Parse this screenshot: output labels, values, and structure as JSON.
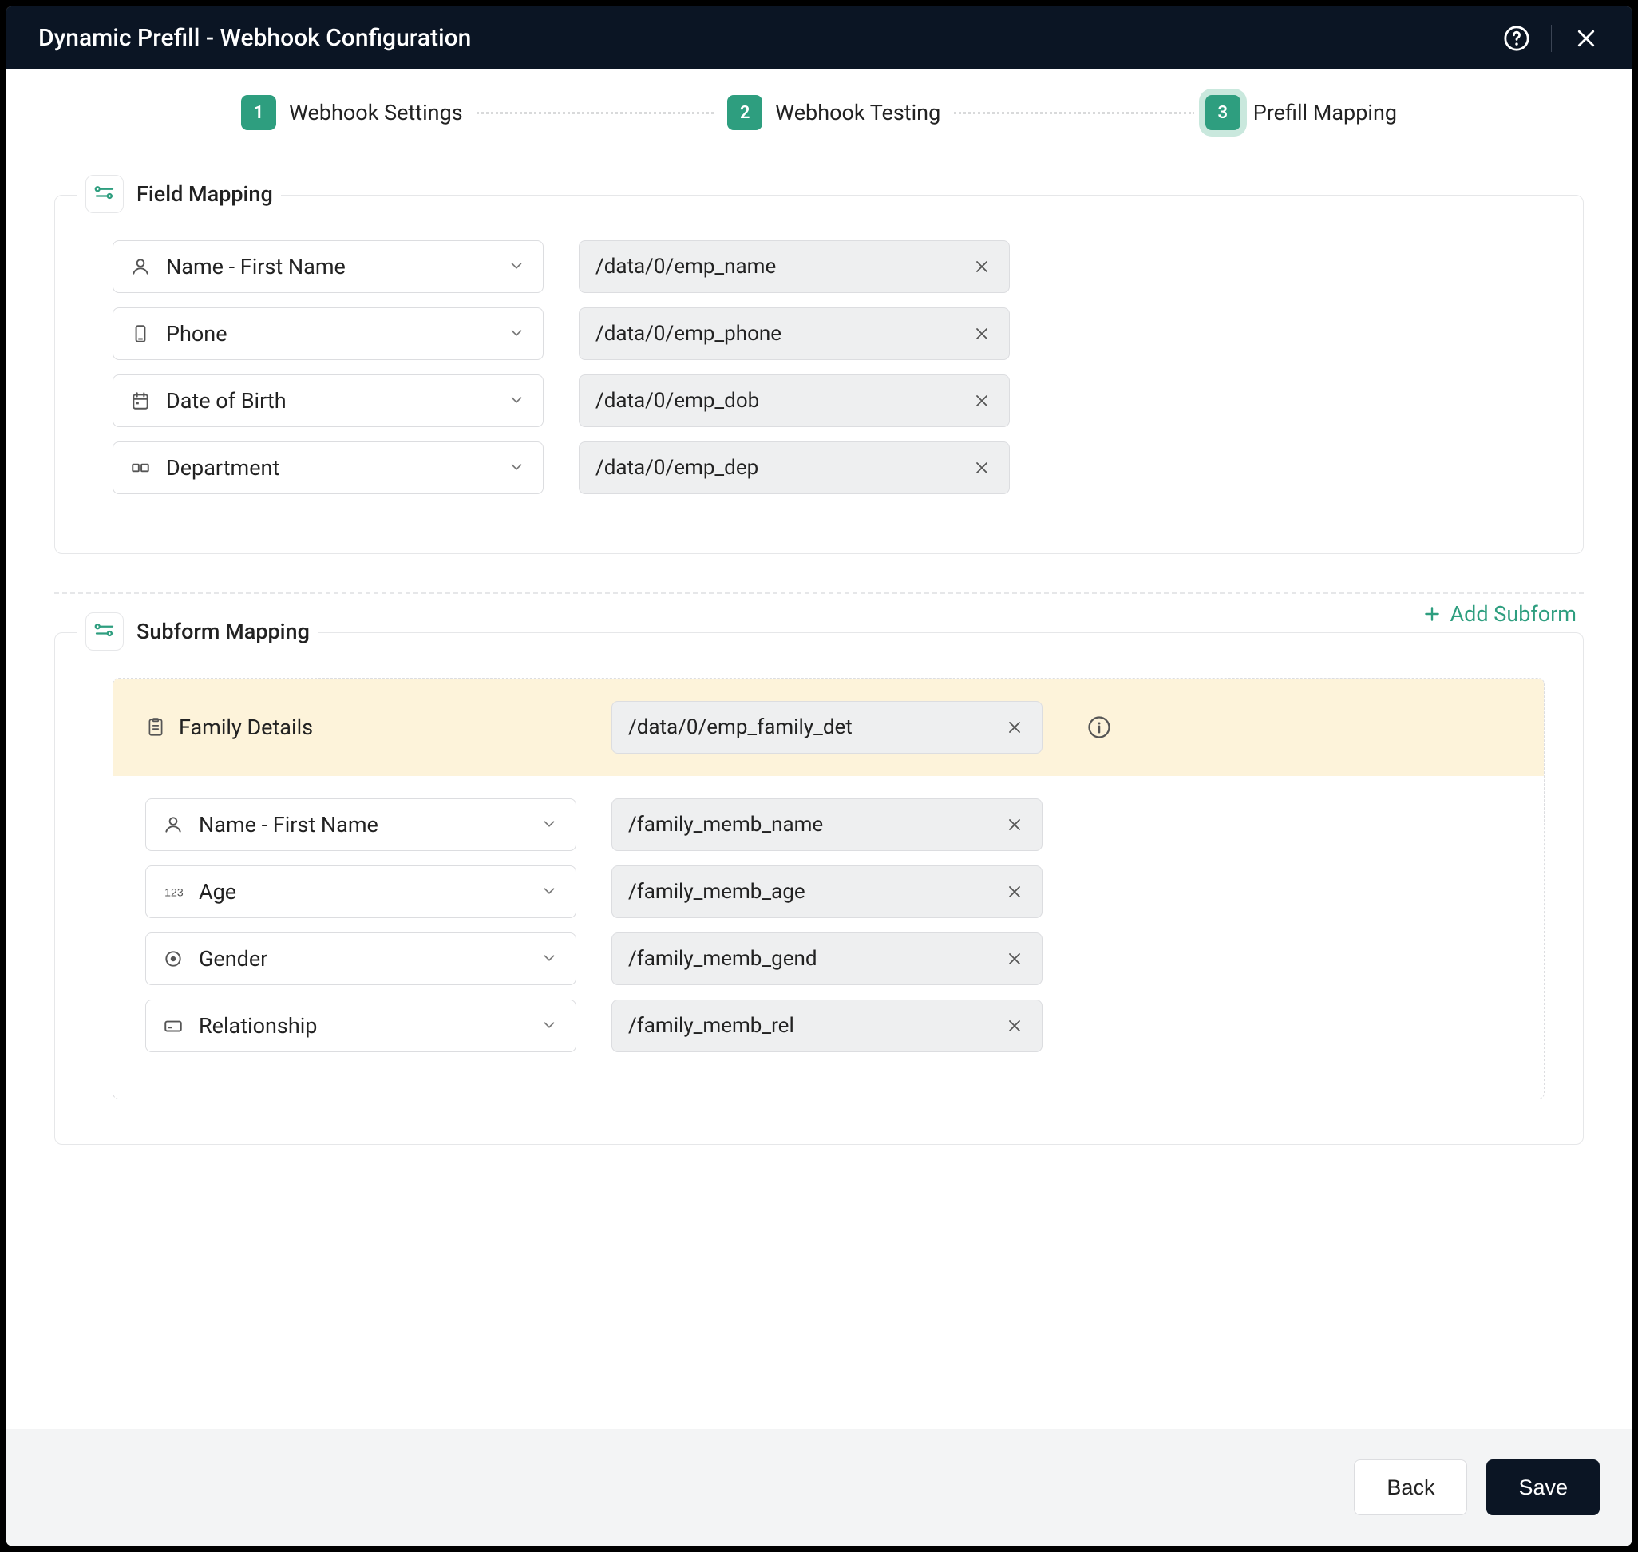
{
  "header": {
    "title": "Dynamic Prefill - Webhook Configuration"
  },
  "stepper": [
    {
      "num": "1",
      "label": "Webhook Settings"
    },
    {
      "num": "2",
      "label": "Webhook Testing"
    },
    {
      "num": "3",
      "label": "Prefill Mapping"
    }
  ],
  "active_step_index": 2,
  "field_mapping": {
    "title": "Field Mapping",
    "rows": [
      {
        "icon": "person",
        "label": "Name - First Name",
        "path": "/data/0/emp_name"
      },
      {
        "icon": "phone",
        "label": "Phone",
        "path": "/data/0/emp_phone"
      },
      {
        "icon": "calendar",
        "label": "Date of Birth",
        "path": "/data/0/emp_dob"
      },
      {
        "icon": "dropdown",
        "label": "Department",
        "path": "/data/0/emp_dep"
      }
    ]
  },
  "subform_mapping": {
    "title": "Subform Mapping",
    "add_label": "Add Subform",
    "subform_name": "Family Details",
    "subform_path": "/data/0/emp_family_det",
    "rows": [
      {
        "icon": "person",
        "label": "Name - First Name",
        "path": "/family_memb_name"
      },
      {
        "icon": "number",
        "label": "Age",
        "path": "/family_memb_age"
      },
      {
        "icon": "radio",
        "label": "Gender",
        "path": "/family_memb_gend"
      },
      {
        "icon": "card",
        "label": "Relationship",
        "path": "/family_memb_rel"
      }
    ]
  },
  "footer": {
    "back": "Back",
    "save": "Save"
  }
}
